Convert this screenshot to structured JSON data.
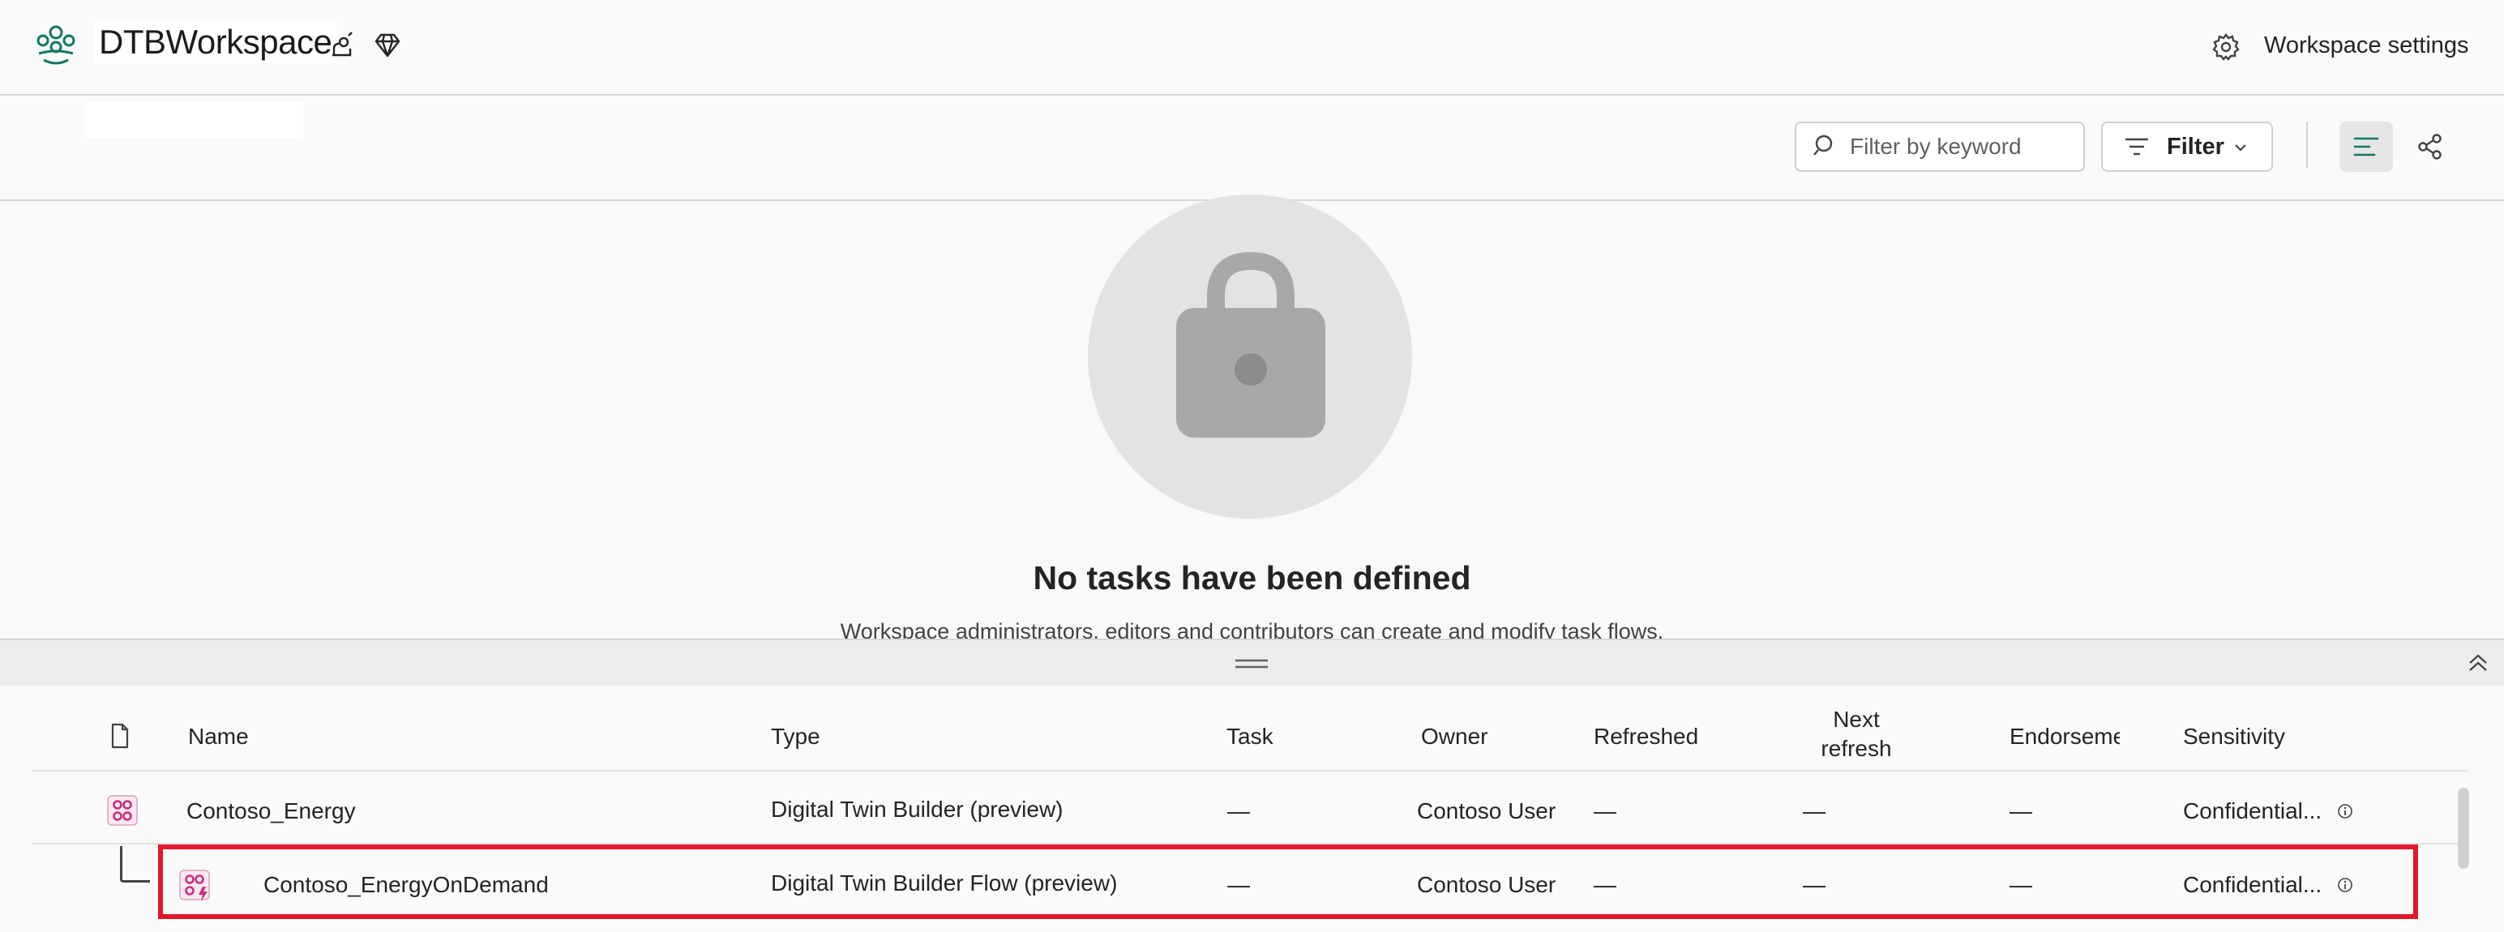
{
  "header": {
    "workspace_title": "DTBWorkspace",
    "settings_label": "Workspace settings",
    "icons": [
      "workspace-logo-icon",
      "rocket-icon",
      "diamond-icon",
      "gear-icon"
    ]
  },
  "toolbar": {
    "search_placeholder": "Filter by keyword",
    "filter_label": "Filter",
    "icons": [
      "search-icon",
      "filter-icon",
      "chevron-down-icon",
      "list-view-icon",
      "lineage-view-icon"
    ]
  },
  "empty_state": {
    "title": "No tasks have been defined",
    "description": "Workspace administrators, editors and contributors can create and modify task flows.",
    "icon": "lock-icon"
  },
  "table": {
    "columns": {
      "name": "Name",
      "type": "Type",
      "task": "Task",
      "owner": "Owner",
      "refreshed": "Refreshed",
      "next_refresh_line1": "Next",
      "next_refresh_line2": "refresh",
      "endorsement": "Endorseme",
      "sensitivity": "Sensitivity"
    },
    "rows": [
      {
        "name": "Contoso_Energy",
        "type": "Digital Twin Builder (preview)",
        "task": "—",
        "owner": "Contoso User",
        "refreshed": "—",
        "next_refresh": "—",
        "endorsement": "—",
        "sensitivity": "Confidential..."
      },
      {
        "name": "Contoso_EnergyOnDemand",
        "type": "Digital Twin Builder Flow (preview)",
        "task": "—",
        "owner": "Contoso User",
        "refreshed": "—",
        "next_refresh": "—",
        "endorsement": "—",
        "sensitivity": "Confidential..."
      }
    ]
  },
  "colors": {
    "accent": "#117865",
    "highlight_border": "#e0182a",
    "item_icon": "#c4317e"
  }
}
